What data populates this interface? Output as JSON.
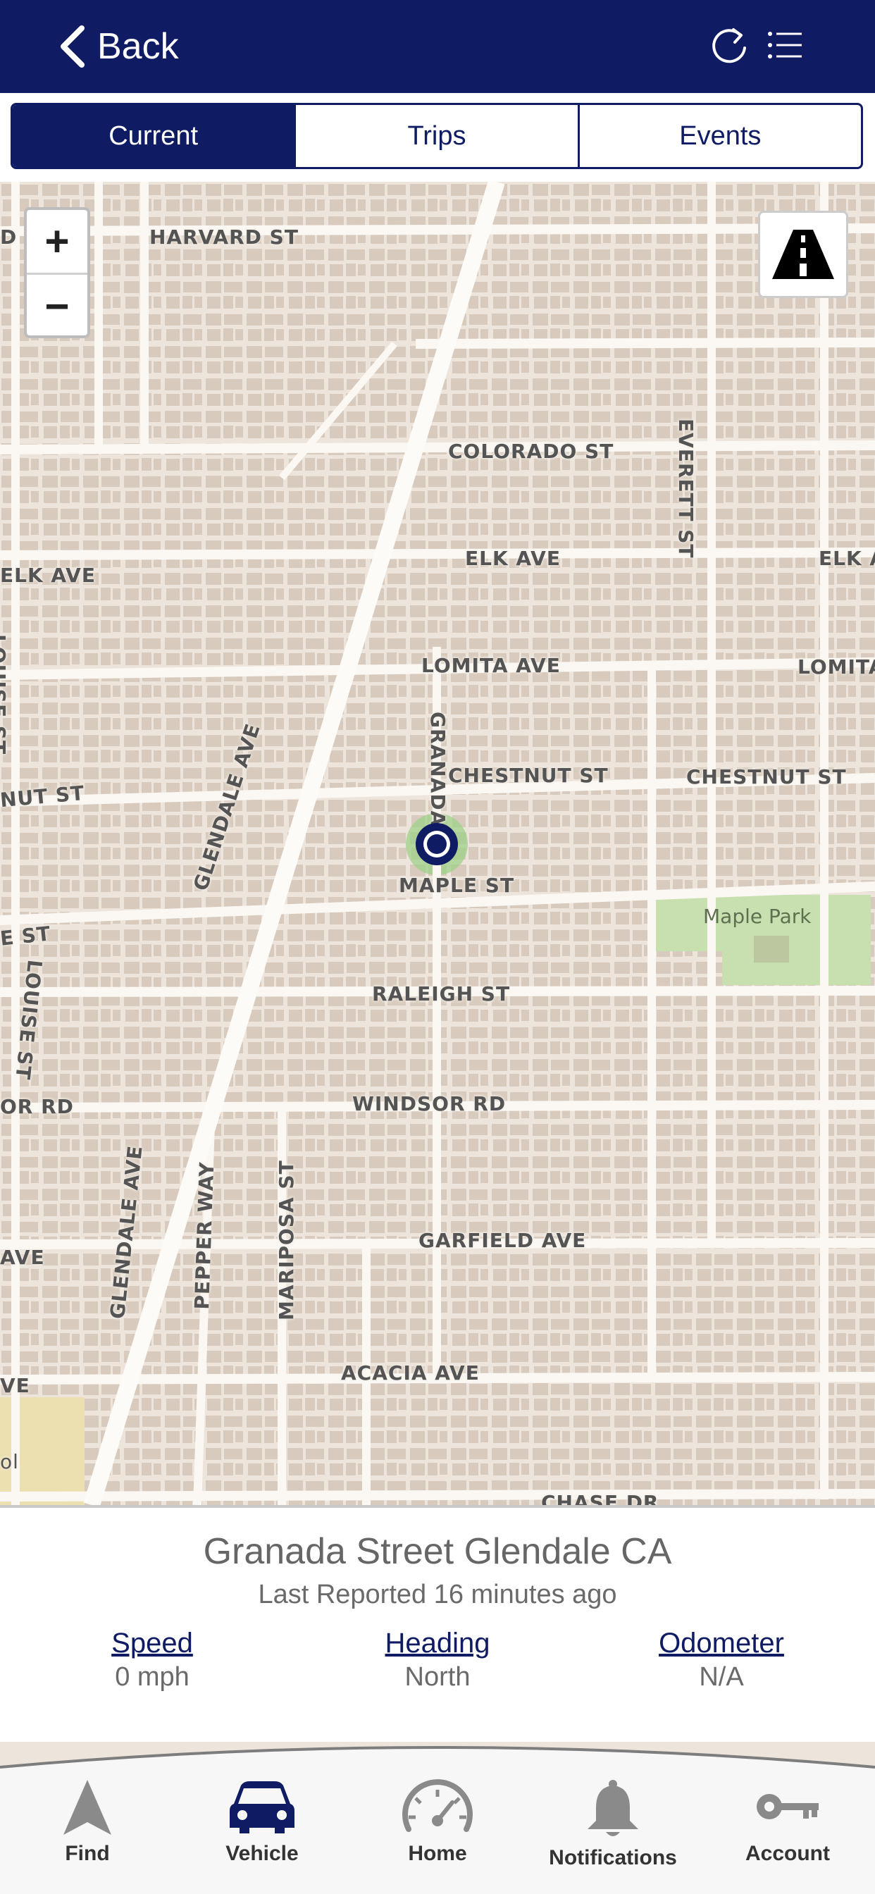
{
  "header": {
    "back_label": "Back",
    "refresh_icon": "refresh-icon",
    "list_icon": "list-icon"
  },
  "segments": [
    {
      "label": "Current",
      "active": true
    },
    {
      "label": "Trips",
      "active": false
    },
    {
      "label": "Events",
      "active": false
    }
  ],
  "map": {
    "zoom_in": "+",
    "zoom_out": "−",
    "streets": {
      "harvard_left": "D ST",
      "harvard": "HARVARD ST",
      "colorado": "COLORADO ST",
      "everett": "EVERETT ST",
      "elk_left": "ELK AVE",
      "elk": "ELK AVE",
      "elk_right": "ELK A",
      "lomita": "LOMITA AVE",
      "lomita_right": "LOMITA",
      "louise_upper": "LOUISE ST",
      "glendale_upper": "GLENDALE AVE",
      "chestnut_left": "NUT ST",
      "granada": "GRANADA",
      "chestnut": "CHESTNUT ST",
      "chestnut_right": "CHESTNUT ST",
      "maple": "MAPLE ST",
      "e_st": "E ST",
      "louise_lower": "LOUISE ST",
      "raleigh": "RALEIGH ST",
      "windsor_left": "OR RD",
      "windsor": "WINDSOR RD",
      "glendale_lower": "GLENDALE AVE",
      "pepper": "PEPPER WAY",
      "mariposa": "MARIPOSA ST",
      "ave_left": "AVE",
      "garfield": "GARFIELD AVE",
      "acacia": "ACACIA AVE",
      "ve_left": "VE",
      "chase": "CHASE DR",
      "ol": "ol"
    },
    "park": "Maple Park",
    "traffic_icon": "traffic-road-icon",
    "marker_icon": "vehicle-location-marker"
  },
  "vehicle": {
    "address": "Granada Street Glendale CA",
    "last_reported": "Last Reported 16 minutes ago",
    "stats": [
      {
        "label": "Speed",
        "value": "0 mph"
      },
      {
        "label": "Heading",
        "value": "North"
      },
      {
        "label": "Odometer",
        "value": "N/A"
      }
    ]
  },
  "tabbar": {
    "items": [
      {
        "label": "Find",
        "icon": "navigation-arrow-icon"
      },
      {
        "label": "Vehicle",
        "icon": "car-icon"
      },
      {
        "label": "Home",
        "icon": "speedometer-icon"
      },
      {
        "label": "Notifications",
        "icon": "bell-icon"
      },
      {
        "label": "Account",
        "icon": "key-icon"
      }
    ],
    "active_color": "#0f1c63",
    "inactive_color": "#8a8a8a"
  },
  "colors": {
    "brand": "#0f1c63",
    "map_bg": "#ede5dc",
    "buildings": "#d8cbbd",
    "park": "#c8e0b0"
  }
}
